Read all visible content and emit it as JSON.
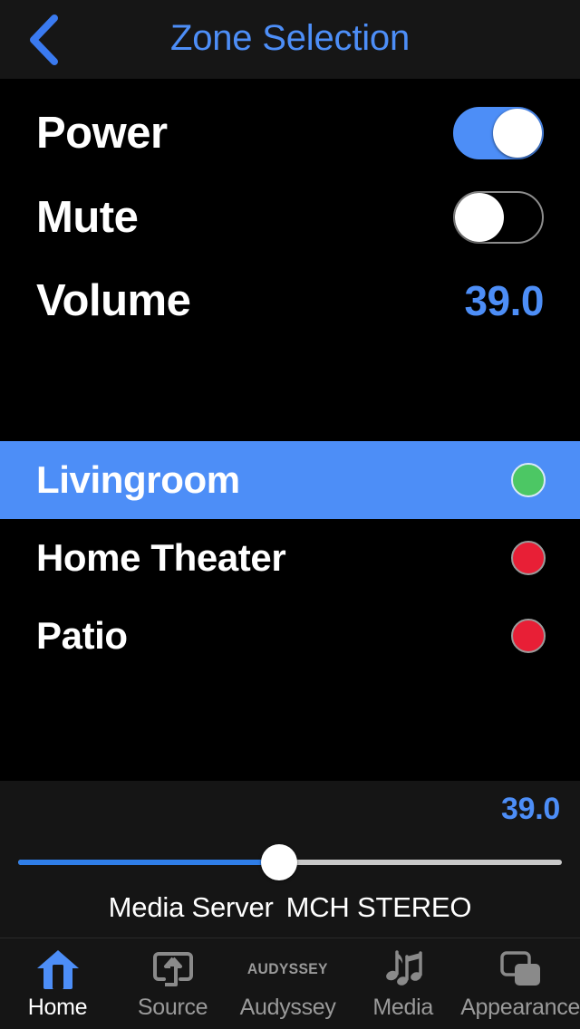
{
  "header": {
    "back_icon": "chevron-left-icon",
    "title": "Zone Selection",
    "accent_color": "#4d8ef7"
  },
  "controls": {
    "rows": [
      {
        "label": "Power",
        "type": "toggle",
        "state": "on",
        "state_label": "ON"
      },
      {
        "label": "Mute",
        "type": "toggle",
        "state": "off",
        "state_label": "OFF"
      },
      {
        "label": "Volume",
        "type": "value",
        "value": "39.0"
      }
    ]
  },
  "zones": {
    "items": [
      {
        "name": "Livingroom",
        "selected": true,
        "status": "green",
        "status_label": "online"
      },
      {
        "name": "Home Theater",
        "selected": false,
        "status": "red",
        "status_label": "offline"
      },
      {
        "name": "Patio",
        "selected": false,
        "status": "red",
        "status_label": "offline"
      }
    ]
  },
  "volume_panel": {
    "value": "39.0",
    "slider_percent": 48,
    "source": "Media Server",
    "mode": "MCH STEREO"
  },
  "tabbar": {
    "tabs": [
      {
        "label": "Home",
        "icon": "home-icon",
        "active": true
      },
      {
        "label": "Source",
        "icon": "source-icon",
        "active": false
      },
      {
        "label": "Audyssey",
        "icon": "audyssey-icon",
        "active": false,
        "logo_text": "AUDYSSEY"
      },
      {
        "label": "Media",
        "icon": "music-notes-icon",
        "active": false
      },
      {
        "label": "Appearance",
        "icon": "appearance-icon",
        "active": false
      }
    ]
  },
  "colors": {
    "accent_blue": "#4d8ef7",
    "slider_blue": "#2f7ee8",
    "status_green": "#4cc764",
    "status_red": "#e81f36",
    "background": "#000000",
    "panel": "#151515"
  }
}
